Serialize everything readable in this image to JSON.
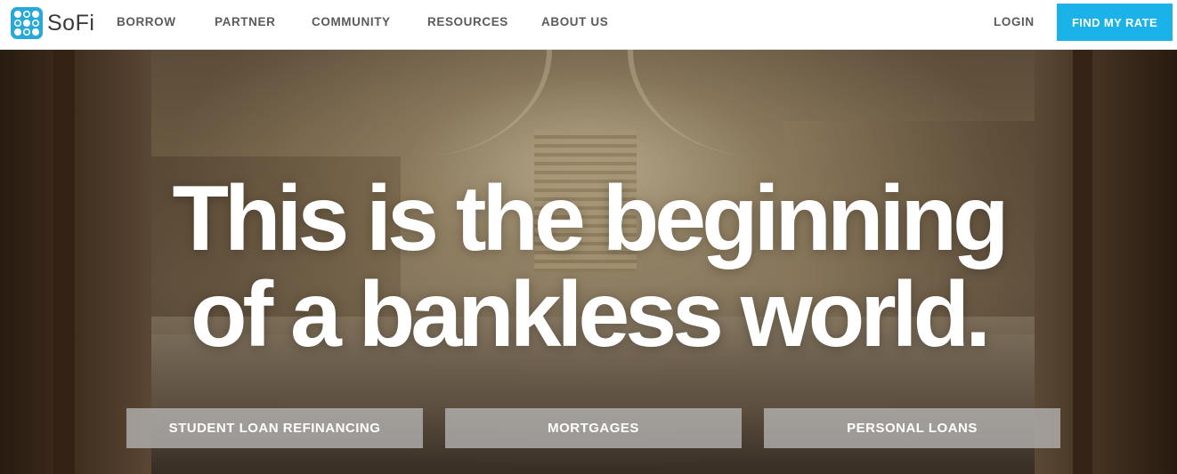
{
  "brand": {
    "name": "SoFi",
    "logo_icon": "sofi-dots-logo-icon",
    "color": "#29a9d8"
  },
  "nav": {
    "items": [
      {
        "label": "BORROW"
      },
      {
        "label": "PARTNER"
      },
      {
        "label": "COMMUNITY"
      },
      {
        "label": "RESOURCES"
      },
      {
        "label": "ABOUT US"
      }
    ],
    "login_label": "LOGIN",
    "cta_label": "FIND MY RATE",
    "cta_color": "#1ab2e8"
  },
  "hero": {
    "headline_line1": "This is the beginning",
    "headline_line2": "of a bankless world.",
    "products": [
      {
        "label": "STUDENT LOAN REFINANCING"
      },
      {
        "label": "MORTGAGES"
      },
      {
        "label": "PERSONAL LOANS"
      }
    ]
  }
}
